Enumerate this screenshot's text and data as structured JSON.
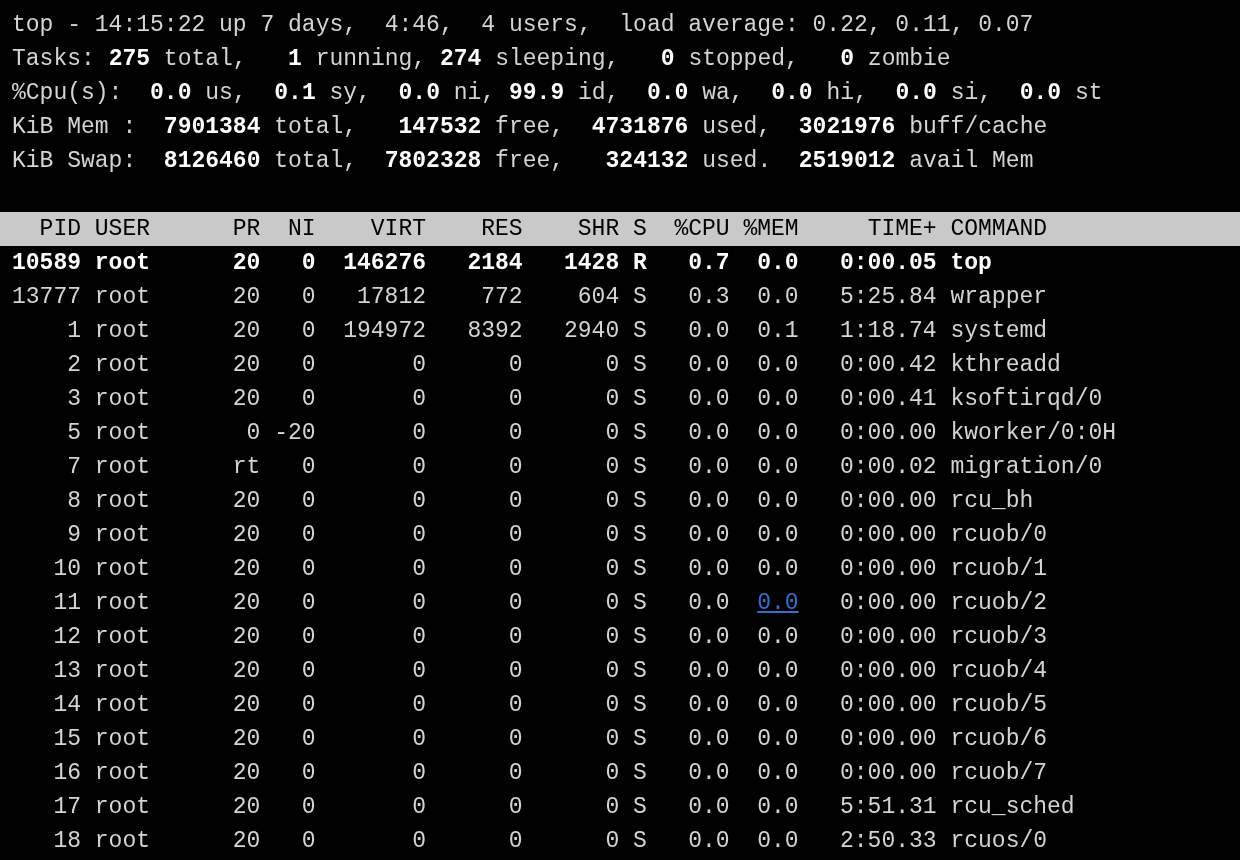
{
  "summary_lines": [
    "top - 14:15:22 up 7 days,  4:46,  4 users,  load average: 0.22, 0.11, 0.07",
    "Tasks: **275** total,   **1** running, **274** sleeping,   **0** stopped,   **0** zombie",
    "%Cpu(s):  **0.0** us,  **0.1** sy,  **0.0** ni, **99.9** id,  **0.0** wa,  **0.0** hi,  **0.0** si,  **0.0** st",
    "KiB Mem :  **7901384** total,   **147532** free,  **4731876** used,  **3021976** buff/cache",
    "KiB Swap:  **8126460** total,  **7802328** free,   **324132** used.  **2519012** avail Mem"
  ],
  "columns": [
    "PID",
    "USER",
    "PR",
    "NI",
    "VIRT",
    "RES",
    "SHR",
    "S",
    "%CPU",
    "%MEM",
    "TIME+",
    "COMMAND"
  ],
  "rows": [
    {
      "pid": "10589",
      "user": "root",
      "pr": "20",
      "ni": "0",
      "virt": "146276",
      "res": "2184",
      "shr": "1428",
      "s": "R",
      "cpu": "0.7",
      "mem": "0.0",
      "time": "0:00.05",
      "command": "top",
      "bold": true,
      "mem_link": false
    },
    {
      "pid": "13777",
      "user": "root",
      "pr": "20",
      "ni": "0",
      "virt": "17812",
      "res": "772",
      "shr": "604",
      "s": "S",
      "cpu": "0.3",
      "mem": "0.0",
      "time": "5:25.84",
      "command": "wrapper",
      "bold": false,
      "mem_link": false
    },
    {
      "pid": "1",
      "user": "root",
      "pr": "20",
      "ni": "0",
      "virt": "194972",
      "res": "8392",
      "shr": "2940",
      "s": "S",
      "cpu": "0.0",
      "mem": "0.1",
      "time": "1:18.74",
      "command": "systemd",
      "bold": false,
      "mem_link": false
    },
    {
      "pid": "2",
      "user": "root",
      "pr": "20",
      "ni": "0",
      "virt": "0",
      "res": "0",
      "shr": "0",
      "s": "S",
      "cpu": "0.0",
      "mem": "0.0",
      "time": "0:00.42",
      "command": "kthreadd",
      "bold": false,
      "mem_link": false
    },
    {
      "pid": "3",
      "user": "root",
      "pr": "20",
      "ni": "0",
      "virt": "0",
      "res": "0",
      "shr": "0",
      "s": "S",
      "cpu": "0.0",
      "mem": "0.0",
      "time": "0:00.41",
      "command": "ksoftirqd/0",
      "bold": false,
      "mem_link": false
    },
    {
      "pid": "5",
      "user": "root",
      "pr": "0",
      "ni": "-20",
      "virt": "0",
      "res": "0",
      "shr": "0",
      "s": "S",
      "cpu": "0.0",
      "mem": "0.0",
      "time": "0:00.00",
      "command": "kworker/0:0H",
      "bold": false,
      "mem_link": false
    },
    {
      "pid": "7",
      "user": "root",
      "pr": "rt",
      "ni": "0",
      "virt": "0",
      "res": "0",
      "shr": "0",
      "s": "S",
      "cpu": "0.0",
      "mem": "0.0",
      "time": "0:00.02",
      "command": "migration/0",
      "bold": false,
      "mem_link": false
    },
    {
      "pid": "8",
      "user": "root",
      "pr": "20",
      "ni": "0",
      "virt": "0",
      "res": "0",
      "shr": "0",
      "s": "S",
      "cpu": "0.0",
      "mem": "0.0",
      "time": "0:00.00",
      "command": "rcu_bh",
      "bold": false,
      "mem_link": false
    },
    {
      "pid": "9",
      "user": "root",
      "pr": "20",
      "ni": "0",
      "virt": "0",
      "res": "0",
      "shr": "0",
      "s": "S",
      "cpu": "0.0",
      "mem": "0.0",
      "time": "0:00.00",
      "command": "rcuob/0",
      "bold": false,
      "mem_link": false
    },
    {
      "pid": "10",
      "user": "root",
      "pr": "20",
      "ni": "0",
      "virt": "0",
      "res": "0",
      "shr": "0",
      "s": "S",
      "cpu": "0.0",
      "mem": "0.0",
      "time": "0:00.00",
      "command": "rcuob/1",
      "bold": false,
      "mem_link": false
    },
    {
      "pid": "11",
      "user": "root",
      "pr": "20",
      "ni": "0",
      "virt": "0",
      "res": "0",
      "shr": "0",
      "s": "S",
      "cpu": "0.0",
      "mem": "0.0",
      "time": "0:00.00",
      "command": "rcuob/2",
      "bold": false,
      "mem_link": true
    },
    {
      "pid": "12",
      "user": "root",
      "pr": "20",
      "ni": "0",
      "virt": "0",
      "res": "0",
      "shr": "0",
      "s": "S",
      "cpu": "0.0",
      "mem": "0.0",
      "time": "0:00.00",
      "command": "rcuob/3",
      "bold": false,
      "mem_link": false
    },
    {
      "pid": "13",
      "user": "root",
      "pr": "20",
      "ni": "0",
      "virt": "0",
      "res": "0",
      "shr": "0",
      "s": "S",
      "cpu": "0.0",
      "mem": "0.0",
      "time": "0:00.00",
      "command": "rcuob/4",
      "bold": false,
      "mem_link": false
    },
    {
      "pid": "14",
      "user": "root",
      "pr": "20",
      "ni": "0",
      "virt": "0",
      "res": "0",
      "shr": "0",
      "s": "S",
      "cpu": "0.0",
      "mem": "0.0",
      "time": "0:00.00",
      "command": "rcuob/5",
      "bold": false,
      "mem_link": false
    },
    {
      "pid": "15",
      "user": "root",
      "pr": "20",
      "ni": "0",
      "virt": "0",
      "res": "0",
      "shr": "0",
      "s": "S",
      "cpu": "0.0",
      "mem": "0.0",
      "time": "0:00.00",
      "command": "rcuob/6",
      "bold": false,
      "mem_link": false
    },
    {
      "pid": "16",
      "user": "root",
      "pr": "20",
      "ni": "0",
      "virt": "0",
      "res": "0",
      "shr": "0",
      "s": "S",
      "cpu": "0.0",
      "mem": "0.0",
      "time": "0:00.00",
      "command": "rcuob/7",
      "bold": false,
      "mem_link": false
    },
    {
      "pid": "17",
      "user": "root",
      "pr": "20",
      "ni": "0",
      "virt": "0",
      "res": "0",
      "shr": "0",
      "s": "S",
      "cpu": "0.0",
      "mem": "0.0",
      "time": "5:51.31",
      "command": "rcu_sched",
      "bold": false,
      "mem_link": false
    },
    {
      "pid": "18",
      "user": "root",
      "pr": "20",
      "ni": "0",
      "virt": "0",
      "res": "0",
      "shr": "0",
      "s": "S",
      "cpu": "0.0",
      "mem": "0.0",
      "time": "2:50.33",
      "command": "rcuos/0",
      "bold": false,
      "mem_link": false
    }
  ]
}
